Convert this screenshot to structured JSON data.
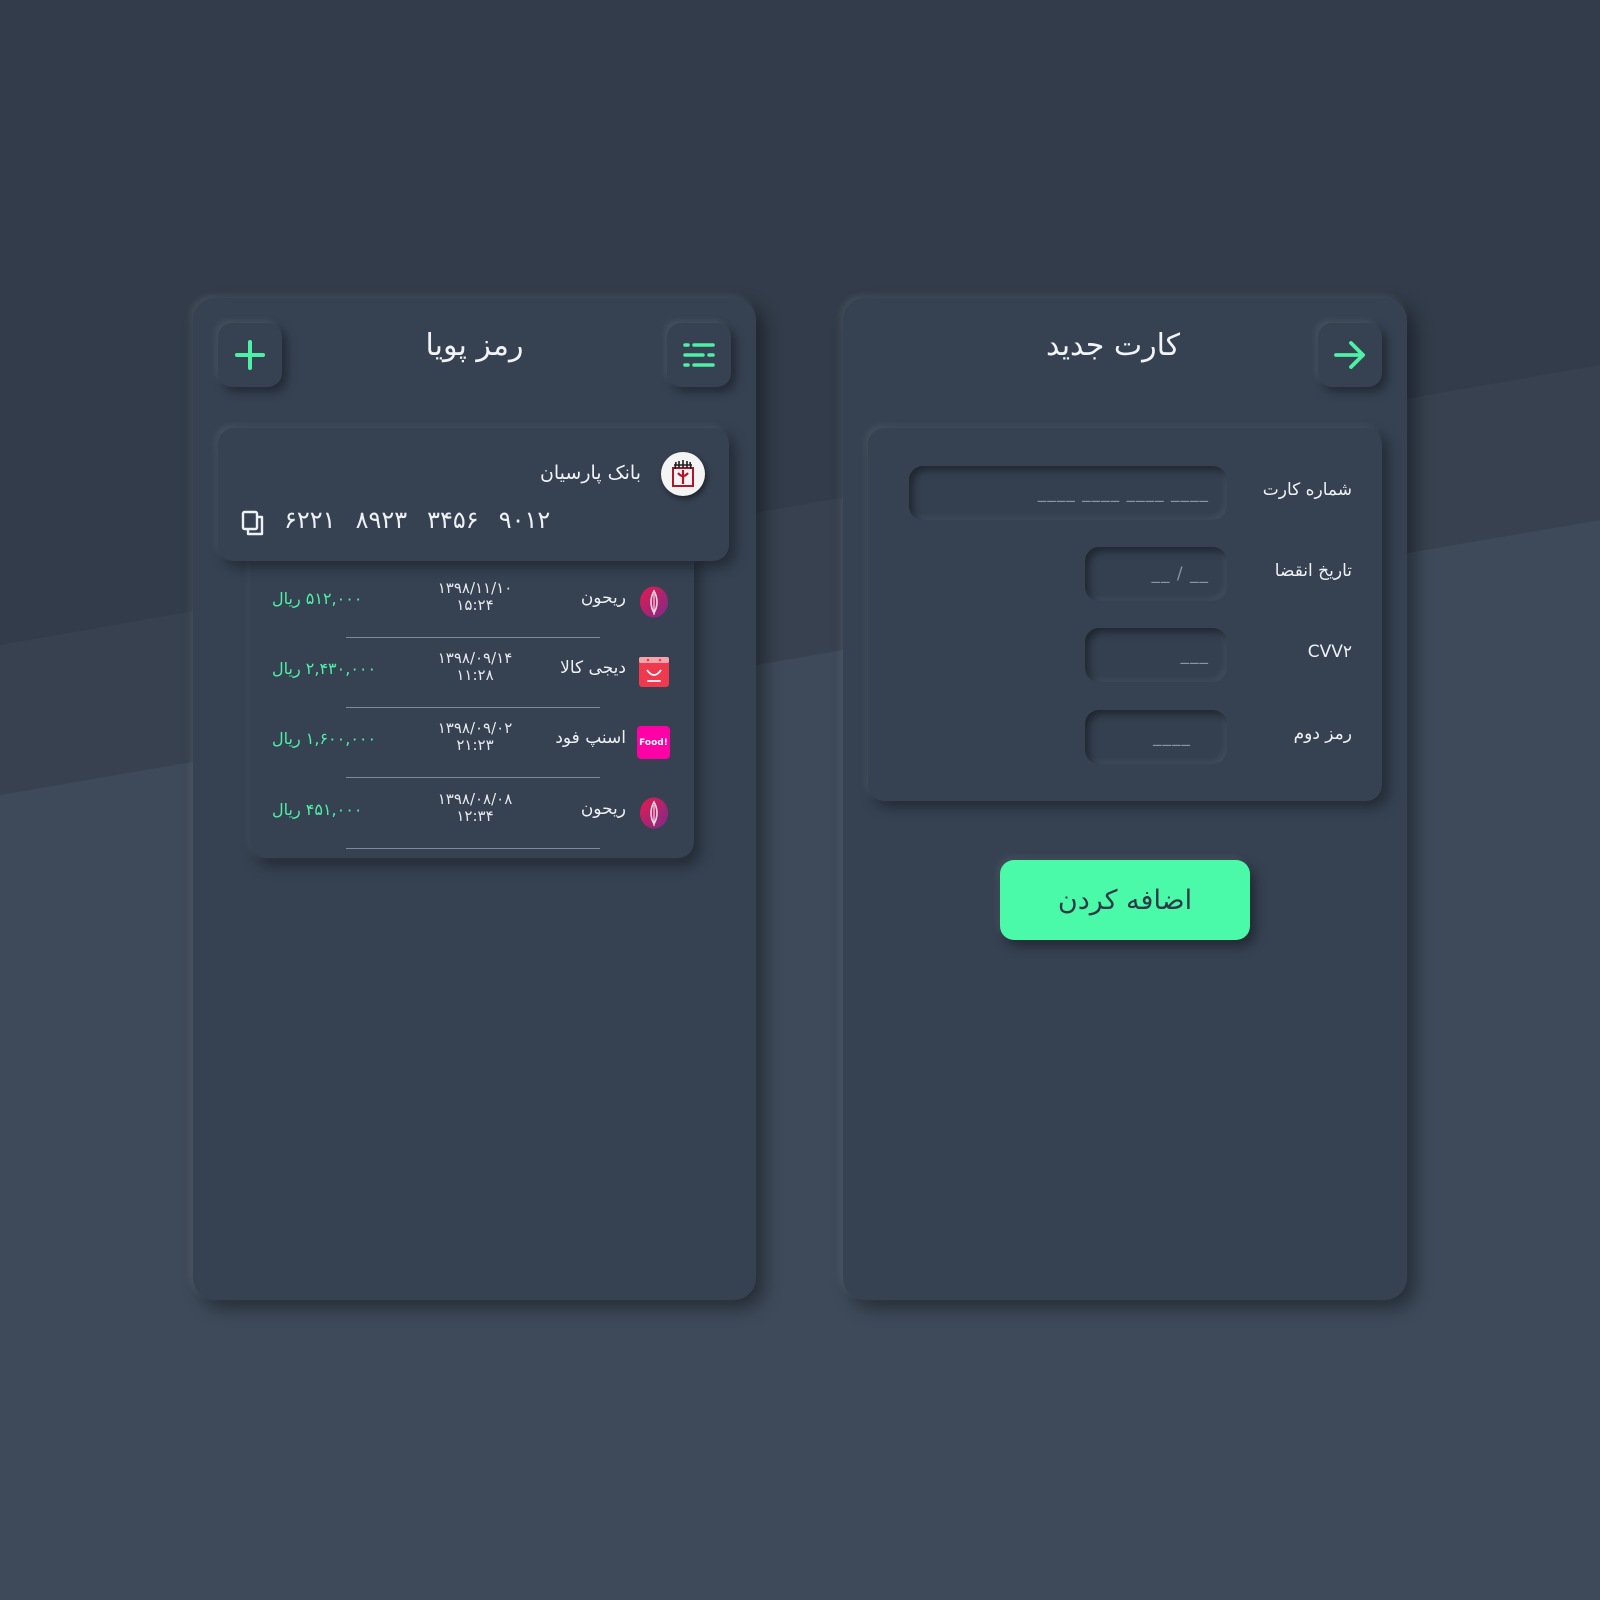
{
  "colors": {
    "accent": "#4bfaa9",
    "panel": "#364252",
    "background_dark": "#323c4a",
    "background_light": "#3e4a5a"
  },
  "wallet": {
    "title": "رمز پویا",
    "add_icon": "plus-icon",
    "menu_icon": "menu-list-icon",
    "bank_card": {
      "bank_name": "بانک پارسیان",
      "logo_icon": "parsian-bank-logo-icon",
      "copy_icon": "copy-icon",
      "number_groups": [
        "۶۲۲۱",
        "۸۹۲۳",
        "۳۴۵۶",
        "۹۰۱۲"
      ]
    },
    "transactions": [
      {
        "merchant": "ریحون",
        "icon": "reyhoon-logo-icon",
        "date": "۱۳۹۸/۱۱/۱۰",
        "time": "۱۵:۲۴",
        "amount": "۵۱۲,۰۰۰ ریال"
      },
      {
        "merchant": "دیجی کالا",
        "icon": "digikala-logo-icon",
        "date": "۱۳۹۸/۰۹/۱۴",
        "time": "۱۱:۲۸",
        "amount": "۲,۴۳۰,۰۰۰ ریال"
      },
      {
        "merchant": "اسنپ فود",
        "icon": "snappfood-logo-icon",
        "icon_text": "Food!",
        "date": "۱۳۹۸/۰۹/۰۲",
        "time": "۲۱:۲۳",
        "amount": "۱,۶۰۰,۰۰۰ ریال"
      },
      {
        "merchant": "ریحون",
        "icon": "reyhoon-logo-icon",
        "date": "۱۳۹۸/۰۸/۰۸",
        "time": "۱۲:۳۴",
        "amount": "۴۵۱,۰۰۰ ریال"
      }
    ]
  },
  "new_card": {
    "title": "کارت جدید",
    "back_icon": "arrow-right-icon",
    "fields": {
      "card_number": {
        "label": "شماره کارت",
        "placeholder": "____ ____ ____ ____",
        "value": ""
      },
      "expiry": {
        "label": "تاریخ انقضا",
        "placeholder": "__ / __",
        "value": ""
      },
      "cvv2": {
        "label": "CVV۲",
        "placeholder": "___",
        "value": ""
      },
      "second_password": {
        "label": "رمز دوم",
        "placeholder": "____",
        "value": ""
      }
    },
    "submit_label": "اضافه کردن"
  }
}
